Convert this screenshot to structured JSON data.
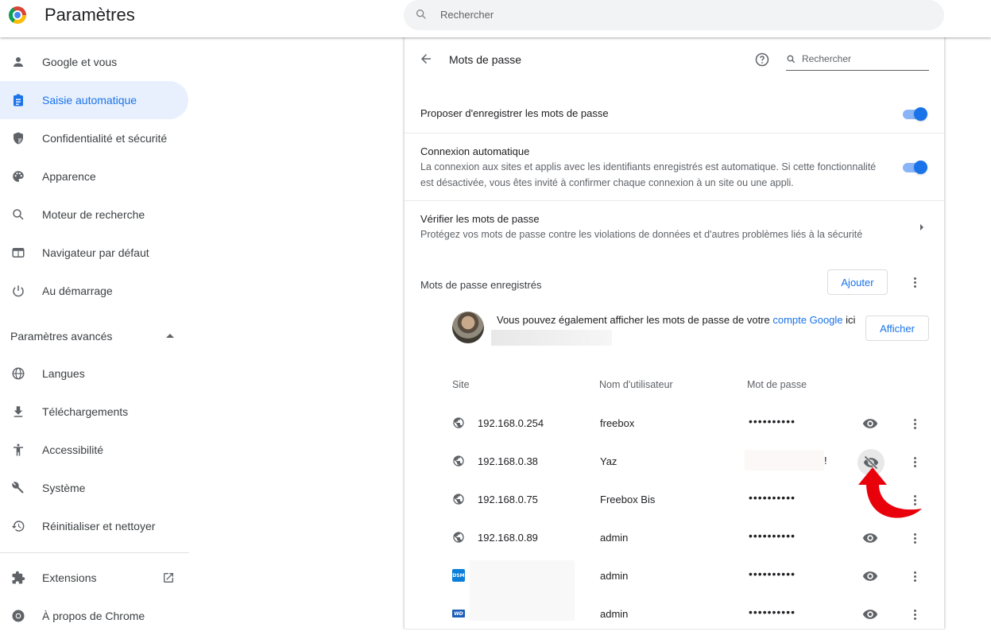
{
  "app": {
    "title": "Paramètres",
    "search_placeholder": "Rechercher"
  },
  "sidebar": {
    "items": [
      {
        "label": "Google et vous",
        "icon": "person-icon"
      },
      {
        "label": "Saisie automatique",
        "icon": "clipboard-icon",
        "active": true
      },
      {
        "label": "Confidentialité et sécurité",
        "icon": "shield-icon"
      },
      {
        "label": "Apparence",
        "icon": "palette-icon"
      },
      {
        "label": "Moteur de recherche",
        "icon": "search-icon"
      },
      {
        "label": "Navigateur par défaut",
        "icon": "browser-icon"
      },
      {
        "label": "Au démarrage",
        "icon": "power-icon"
      }
    ],
    "advanced_label": "Paramètres avancés",
    "advanced_items": [
      {
        "label": "Langues",
        "icon": "globe-icon"
      },
      {
        "label": "Téléchargements",
        "icon": "download-icon"
      },
      {
        "label": "Accessibilité",
        "icon": "accessibility-icon"
      },
      {
        "label": "Système",
        "icon": "wrench-icon"
      },
      {
        "label": "Réinitialiser et nettoyer",
        "icon": "restore-icon"
      }
    ],
    "extensions_label": "Extensions",
    "about_label": "À propos de Chrome"
  },
  "passwords": {
    "title": "Mots de passe",
    "search_placeholder": "Rechercher",
    "offer_save": {
      "label": "Proposer d'enregistrer les mots de passe",
      "enabled": true
    },
    "auto_signin": {
      "label": "Connexion automatique",
      "description": "La connexion aux sites et applis avec les identifiants enregistrés est automatique. Si cette fonctionnalité est désactivée, vous êtes invité à confirmer chaque connexion à un site ou une appli.",
      "enabled": true
    },
    "check": {
      "label": "Vérifier les mots de passe",
      "description": "Protégez vos mots de passe contre les violations de données et d'autres problèmes liés à la sécurité"
    },
    "saved_title": "Mots de passe enregistrés",
    "add_label": "Ajouter",
    "account_text_before": "Vous pouvez également afficher les mots de passe de votre ",
    "account_link": "compte Google",
    "account_text_after": " ici",
    "show_label": "Afficher",
    "columns": {
      "site": "Site",
      "username": "Nom d'utilisateur",
      "password": "Mot de passe"
    },
    "rows": [
      {
        "site": "192.168.0.254",
        "username": "freebox",
        "password": "••••••••••",
        "icon": "globe",
        "revealed": false
      },
      {
        "site": "192.168.0.38",
        "username": "Yaz",
        "password": "!",
        "icon": "globe",
        "revealed": true
      },
      {
        "site": "192.168.0.75",
        "username": "Freebox Bis",
        "password": "••••••••••",
        "icon": "globe",
        "revealed": false
      },
      {
        "site": "192.168.0.89",
        "username": "admin",
        "password": "••••••••••",
        "icon": "globe",
        "revealed": false
      },
      {
        "site": "",
        "username": "admin",
        "password": "••••••••••",
        "icon": "dsm",
        "icon_text": "DSM",
        "revealed": false
      },
      {
        "site": "",
        "username": "admin",
        "password": "••••••••••",
        "icon": "wd",
        "icon_text": "WD",
        "revealed": false
      }
    ]
  },
  "colors": {
    "accent": "#1a73e8",
    "active_bg": "#e8f0fe",
    "toggle_track": "#8ab4f8",
    "annotation_arrow": "#e8000b"
  }
}
